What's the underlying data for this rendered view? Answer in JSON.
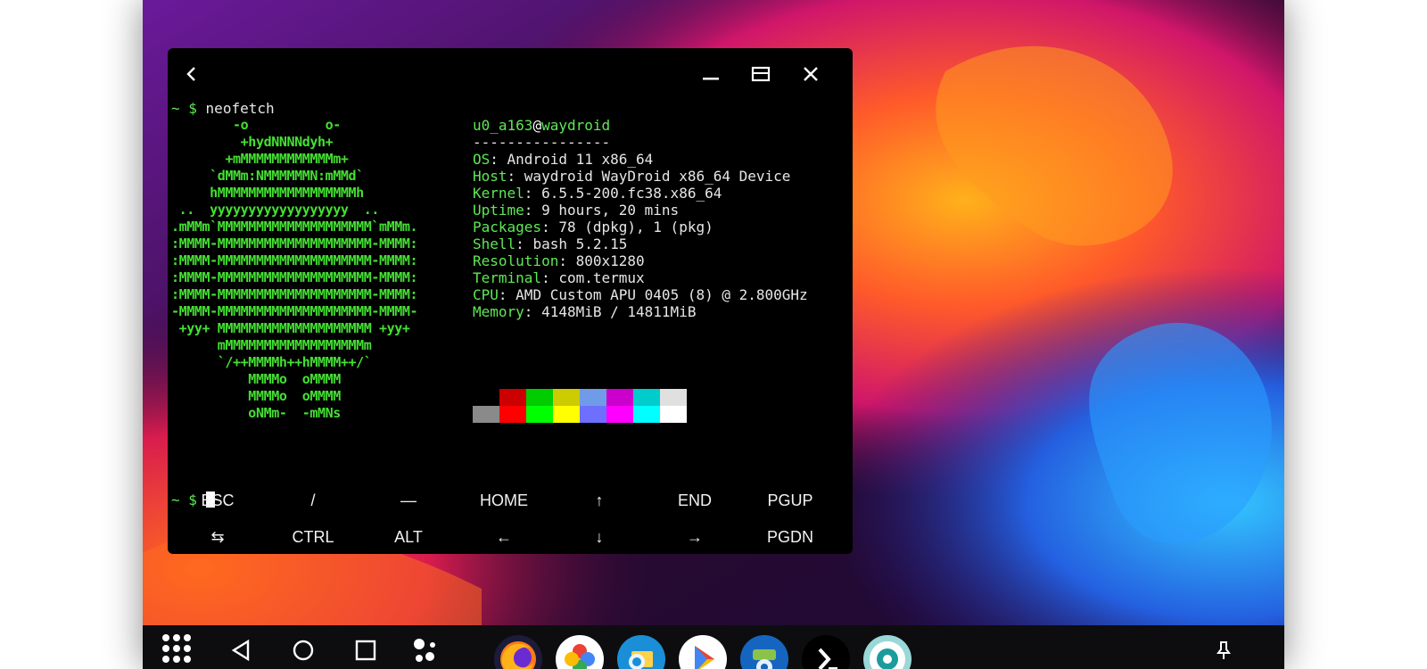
{
  "terminal": {
    "prompt_symbol": "~ $",
    "command": "neofetch",
    "ascii_art": [
      "        -o          o-",
      "         +hydNNNNdyh+",
      "       +mMMMMMMMMMMMMm+",
      "     `dMMm:NMMMMMMN:mMMd`",
      "     hMMMMMMMMMMMMMMMMMMh",
      " ..  yyyyyyyyyyyyyyyyyy  ..",
      ".mMMm`MMMMMMMMMMMMMMMMMMMM`mMMm.",
      ":MMMM-MMMMMMMMMMMMMMMMMMMM-MMMM:",
      ":MMMM-MMMMMMMMMMMMMMMMMMMM-MMMM:",
      ":MMMM-MMMMMMMMMMMMMMMMMMMM-MMMM:",
      ":MMMM-MMMMMMMMMMMMMMMMMMMM-MMMM:",
      "-MMMM-MMMMMMMMMMMMMMMMMMMM-MMMM-",
      " +yy+ MMMMMMMMMMMMMMMMMMMM +yy+",
      "      mMMMMMMMMMMMMMMMMMMm",
      "      `/++MMMMh++hMMMM++/`",
      "          MMMMo  oMMMM",
      "          MMMMo  oMMMM",
      "          oNMm-  -mMNs"
    ],
    "user": "u0_a163",
    "at": "@",
    "host": "waydroid",
    "separator": "----------------",
    "info": [
      {
        "key": "OS",
        "value": ": Android 11 x86_64"
      },
      {
        "key": "Host",
        "value": ": waydroid WayDroid x86_64 Device"
      },
      {
        "key": "Kernel",
        "value": ": 6.5.5-200.fc38.x86_64"
      },
      {
        "key": "Uptime",
        "value": ": 9 hours, 20 mins"
      },
      {
        "key": "Packages",
        "value": ": 78 (dpkg), 1 (pkg)"
      },
      {
        "key": "Shell",
        "value": ": bash 5.2.15"
      },
      {
        "key": "Resolution",
        "value": ": 800x1280"
      },
      {
        "key": "Terminal",
        "value": ": com.termux"
      },
      {
        "key": "CPU",
        "value": ": AMD Custom APU 0405 (8) @ 2.800GHz"
      },
      {
        "key": "Memory",
        "value": ": 4148MiB / 14811MiB"
      }
    ],
    "palette_top": [
      "#000000",
      "#cc0000",
      "#00cc00",
      "#cccc00",
      "#6f9be8",
      "#cc00cc",
      "#00cccc",
      "#e0e0e0"
    ],
    "palette_bottom": [
      "#8a8a8a",
      "#ff0000",
      "#00ff00",
      "#ffff00",
      "#6f6fff",
      "#ff00ff",
      "#00ffff",
      "#ffffff"
    ],
    "second_prompt": "~ $"
  },
  "extra_keys": {
    "row1": [
      "ESC",
      "/",
      "—",
      "HOME",
      "↑",
      "END",
      "PGUP"
    ],
    "row2": [
      "⇆",
      "CTRL",
      "ALT",
      "←",
      "↓",
      "→",
      "PGDN"
    ]
  },
  "window_controls": {
    "back_icon": "back-chevron-icon",
    "minimize_icon": "minimize-icon",
    "maximize_icon": "maximize-icon",
    "close_icon": "close-icon"
  },
  "taskbar": {
    "nav_icons": [
      "app-drawer-icon",
      "back-icon",
      "home-icon",
      "recents-icon",
      "assistant-icon"
    ],
    "apps": [
      "firefox-icon",
      "google-photos-icon",
      "file-manager-icon",
      "play-store-icon",
      "fdroid-icon",
      "termux-icon",
      "lens-icon"
    ],
    "pin_icon": "pin-icon"
  }
}
